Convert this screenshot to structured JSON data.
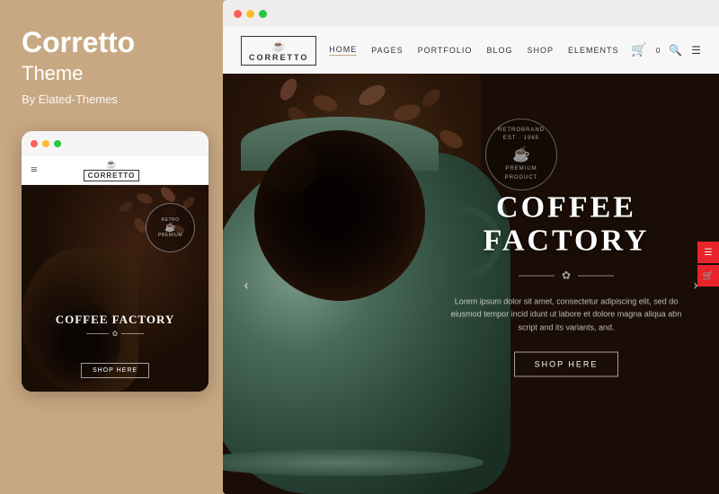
{
  "left": {
    "title": "Corretto",
    "subtitle": "Theme",
    "by": "By Elated-Themes"
  },
  "mobile": {
    "logo_text": "CORRETTO",
    "hero_title": "COFFEE FACTORY",
    "shop_btn": "SHOP HERE",
    "divider_icon": "✿"
  },
  "desktop": {
    "browser_dots": [
      "red",
      "yellow",
      "green"
    ],
    "logo_icon": "☕",
    "logo_text": "CORRETTO",
    "nav_links": [
      {
        "label": "HOME",
        "active": true
      },
      {
        "label": "PAGES",
        "active": false
      },
      {
        "label": "PORTFOLIO",
        "active": false
      },
      {
        "label": "BLOG",
        "active": false
      },
      {
        "label": "SHOP",
        "active": false
      },
      {
        "label": "ELEMENTS",
        "active": false
      }
    ],
    "cart_label": "0",
    "hero_title": "COFFEE FACTORY",
    "hero_desc": "Lorem ipsum dolor sit amet, consectetur adipiscing elit, sed do eiusmod tempor incid idunt ut labore et dolore magna aliqua abn script and its variants, and.",
    "shop_btn": "SHOP HERE",
    "divider_icon": "✿",
    "badge_lines": [
      "RETROBRAND",
      "EST",
      "1965",
      "PREMIUM PRODUCT"
    ],
    "arrow_left": "‹",
    "arrow_right": "›"
  },
  "colors": {
    "bg_tan": "#c8a882",
    "dark_brown": "#1a0d06",
    "teal": "#4a6b5a",
    "red": "#e8242a",
    "white": "#ffffff",
    "nav_bg": "#f0eeec"
  }
}
